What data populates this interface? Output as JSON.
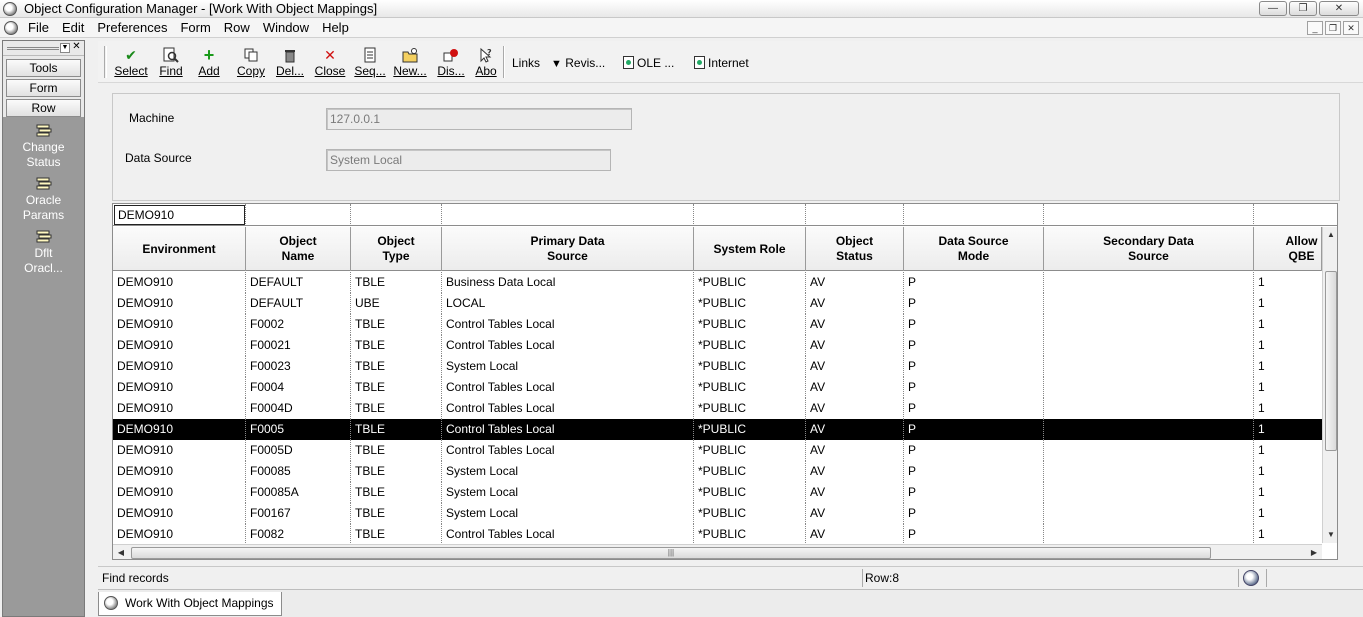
{
  "window": {
    "title": "Object Configuration Manager - [Work With Object Mappings]",
    "controls": [
      "—",
      "❐",
      "✕"
    ]
  },
  "menu": {
    "items": [
      "File",
      "Edit",
      "Preferences",
      "Form",
      "Row",
      "Window",
      "Help"
    ],
    "mdi_controls": [
      "_",
      "❐",
      "✕"
    ]
  },
  "left_panel": {
    "tabs": [
      "Tools",
      "Form",
      "Row"
    ],
    "items": [
      {
        "line1": "Change",
        "line2": "Status"
      },
      {
        "line1": "Oracle",
        "line2": "Params"
      },
      {
        "line1": "Dflt",
        "line2": "Oracl..."
      }
    ]
  },
  "toolbar": {
    "buttons": [
      {
        "label": "Select",
        "icon": "checkmark-icon",
        "glyph": "✔",
        "color": "#1a8a1a"
      },
      {
        "label": "Find",
        "icon": "find-icon",
        "glyph": "🔍",
        "color": "#333333"
      },
      {
        "label": "Add",
        "icon": "plus-icon",
        "glyph": "+",
        "color": "#1a9a1a"
      },
      {
        "label": "Copy",
        "icon": "copy-icon",
        "glyph": "⧉",
        "color": "#333333"
      },
      {
        "label": "Del...",
        "icon": "trash-icon",
        "glyph": "🗑",
        "color": "#333333"
      },
      {
        "label": "Close",
        "icon": "close-icon",
        "glyph": "✕",
        "color": "#d01010"
      },
      {
        "label": "Seq...",
        "icon": "sequence-icon",
        "glyph": "☰",
        "color": "#333333"
      },
      {
        "label": "New...",
        "icon": "new-folder-icon",
        "glyph": "🗀",
        "color": "#b08a00"
      },
      {
        "label": "Dis...",
        "icon": "display-icon",
        "glyph": "●",
        "color": "#d01010"
      },
      {
        "label": "Abo",
        "icon": "about-icon",
        "glyph": "?",
        "color": "#333333"
      }
    ],
    "links_label": "Links",
    "revis_label": "Revis...",
    "ole_label": "OLE ...",
    "internet_label": "Internet"
  },
  "form": {
    "machine_label": "Machine",
    "machine_value": "127.0.0.1",
    "datasource_label": "Data Source",
    "datasource_value": "System Local"
  },
  "grid": {
    "qbe_environment": "DEMO910",
    "columns": [
      "Environment",
      "Object Name",
      "Object Type",
      "Primary Data Source",
      "System Role",
      "Object Status",
      "Data Source Mode",
      "Secondary Data Source",
      "Allow QBE"
    ],
    "rows": [
      [
        "DEMO910",
        "DEFAULT",
        "TBLE",
        "Business Data Local",
        "*PUBLIC",
        "AV",
        "P",
        "",
        "1"
      ],
      [
        "DEMO910",
        "DEFAULT",
        "UBE",
        "LOCAL",
        "*PUBLIC",
        "AV",
        "P",
        "",
        "1"
      ],
      [
        "DEMO910",
        "F0002",
        "TBLE",
        "Control Tables Local",
        "*PUBLIC",
        "AV",
        "P",
        "",
        "1"
      ],
      [
        "DEMO910",
        "F00021",
        "TBLE",
        "Control Tables Local",
        "*PUBLIC",
        "AV",
        "P",
        "",
        "1"
      ],
      [
        "DEMO910",
        "F00023",
        "TBLE",
        "System Local",
        "*PUBLIC",
        "AV",
        "P",
        "",
        "1"
      ],
      [
        "DEMO910",
        "F0004",
        "TBLE",
        "Control Tables Local",
        "*PUBLIC",
        "AV",
        "P",
        "",
        "1"
      ],
      [
        "DEMO910",
        "F0004D",
        "TBLE",
        "Control Tables Local",
        "*PUBLIC",
        "AV",
        "P",
        "",
        "1"
      ],
      [
        "DEMO910",
        "F0005",
        "TBLE",
        "Control Tables Local",
        "*PUBLIC",
        "AV",
        "P",
        "",
        "1"
      ],
      [
        "DEMO910",
        "F0005D",
        "TBLE",
        "Control Tables Local",
        "*PUBLIC",
        "AV",
        "P",
        "",
        "1"
      ],
      [
        "DEMO910",
        "F00085",
        "TBLE",
        "System Local",
        "*PUBLIC",
        "AV",
        "P",
        "",
        "1"
      ],
      [
        "DEMO910",
        "F00085A",
        "TBLE",
        "System Local",
        "*PUBLIC",
        "AV",
        "P",
        "",
        "1"
      ],
      [
        "DEMO910",
        "F00167",
        "TBLE",
        "System Local",
        "*PUBLIC",
        "AV",
        "P",
        "",
        "1"
      ],
      [
        "DEMO910",
        "F0082",
        "TBLE",
        "Control Tables Local",
        "*PUBLIC",
        "AV",
        "P",
        "",
        "1"
      ]
    ],
    "selected_row": 7
  },
  "status": {
    "message": "Find records",
    "row_indicator": "Row:8"
  },
  "bottom_tab": {
    "label": "Work With Object Mappings"
  }
}
